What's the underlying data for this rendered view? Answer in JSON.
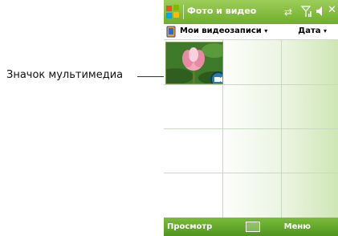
{
  "callout": {
    "label": "Значок мультимедиа"
  },
  "titlebar": {
    "title": "Фото и видео",
    "icons": [
      "windows-start-icon",
      "sync-icon",
      "signal-icon",
      "volume-icon",
      "close-icon"
    ]
  },
  "toolbar": {
    "folder_label": "Мои видеозаписи",
    "sort_label": "Дата"
  },
  "grid": {
    "items": [
      {
        "kind": "video",
        "thumbnail": "pink-lotus-flower",
        "badge": "media-icon"
      }
    ]
  },
  "softkeys": {
    "left": "Просмотр",
    "right": "Меню"
  },
  "colors": {
    "titlebar": "#7bbd3a",
    "softbar": "#5aa326",
    "grid_tint": "#cfe6b6",
    "media_badge": "#2c7bb0"
  }
}
